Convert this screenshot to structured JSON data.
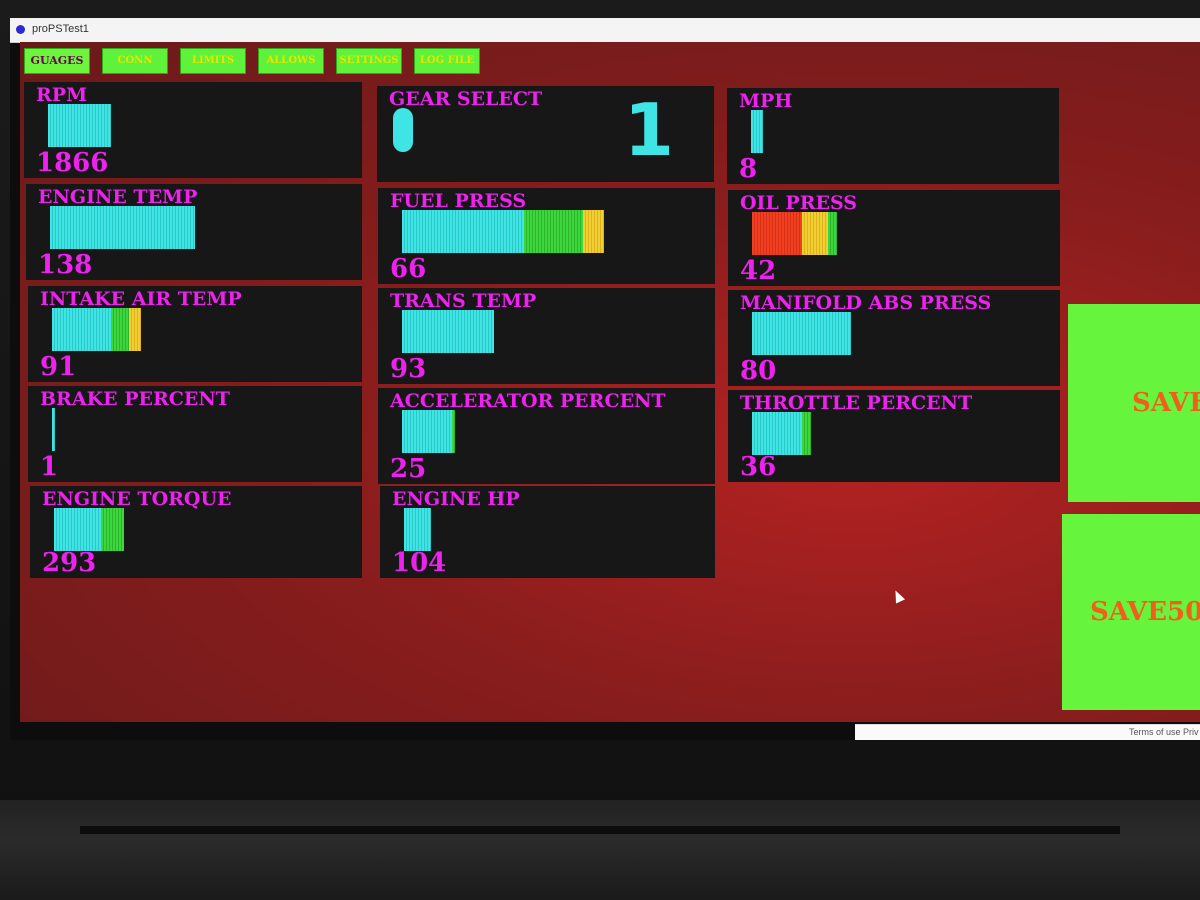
{
  "window": {
    "title": "proPSTest1"
  },
  "tabs": [
    {
      "label": "GUAGES",
      "active": true
    },
    {
      "label": "CONN",
      "active": false
    },
    {
      "label": "LIMITS",
      "active": false
    },
    {
      "label": "ALLOWS",
      "active": false
    },
    {
      "label": "SETTINGS",
      "active": false
    },
    {
      "label": "LOG FILE",
      "active": false
    }
  ],
  "gauges": {
    "rpm": {
      "label": "RPM",
      "value": "1866",
      "segments": [
        {
          "color": "cyan",
          "frac": 0.21
        }
      ]
    },
    "gear": {
      "label": "GEAR SELECT",
      "value": "1"
    },
    "mph": {
      "label": "MPH",
      "value": "8",
      "segments": [
        {
          "color": "cyan",
          "frac": 0.04
        }
      ]
    },
    "engine_temp": {
      "label": "ENGINE TEMP",
      "value": "138",
      "segments": [
        {
          "color": "cyan",
          "frac": 0.49
        }
      ]
    },
    "fuel_press": {
      "label": "FUEL PRESS",
      "value": "66",
      "segments": [
        {
          "color": "cyan",
          "frac": 0.41
        },
        {
          "color": "green",
          "frac": 0.2
        },
        {
          "color": "yellow",
          "frac": 0.07
        }
      ]
    },
    "oil_press": {
      "label": "OIL PRESS",
      "value": "42",
      "segments": [
        {
          "color": "red",
          "frac": 0.17
        },
        {
          "color": "yellow",
          "frac": 0.09
        },
        {
          "color": "green",
          "frac": 0.03
        }
      ]
    },
    "intake_air_temp": {
      "label": "INTAKE AIR TEMP",
      "value": "91",
      "segments": [
        {
          "color": "cyan",
          "frac": 0.2
        },
        {
          "color": "green",
          "frac": 0.06
        },
        {
          "color": "yellow",
          "frac": 0.04
        }
      ]
    },
    "trans_temp": {
      "label": "TRANS TEMP",
      "value": "93",
      "segments": [
        {
          "color": "cyan",
          "frac": 0.31
        }
      ]
    },
    "manifold_abs_press": {
      "label": "MANIFOLD ABS PRESS",
      "value": "80",
      "segments": [
        {
          "color": "cyan",
          "frac": 0.34
        }
      ]
    },
    "brake_percent": {
      "label": "BRAKE PERCENT",
      "value": "1",
      "segments": [
        {
          "color": "cyan",
          "frac": 0.01
        }
      ]
    },
    "accelerator_percent": {
      "label": "ACCELERATOR PERCENT",
      "value": "25",
      "segments": [
        {
          "color": "cyan",
          "frac": 0.17
        },
        {
          "color": "green",
          "frac": 0.01
        }
      ]
    },
    "throttle_percent": {
      "label": "THROTTLE PERCENT",
      "value": "36",
      "segments": [
        {
          "color": "cyan",
          "frac": 0.17
        },
        {
          "color": "green",
          "frac": 0.03
        }
      ]
    },
    "engine_torque": {
      "label": "ENGINE TORQUE",
      "value": "293",
      "segments": [
        {
          "color": "cyan",
          "frac": 0.16
        },
        {
          "color": "green",
          "frac": 0.08
        }
      ]
    },
    "engine_hp": {
      "label": "ENGINE HP",
      "value": "104",
      "segments": [
        {
          "color": "cyan",
          "frac": 0.09
        }
      ]
    }
  },
  "buttons": {
    "save": "SAVE",
    "save50": "SAVE50"
  },
  "footer": {
    "terms": "Terms of use",
    "privacy": "Priv"
  },
  "colors": {
    "background": "#8a1d1d",
    "tab": "#5ef23a",
    "label": "#ee22ee",
    "bar": "#3fe5e5",
    "button_text": "#f06018"
  }
}
